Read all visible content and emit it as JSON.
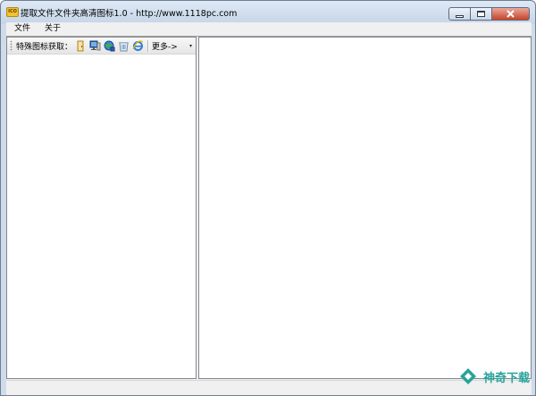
{
  "window": {
    "title": "提取文件文件夹高清图标1.0 - http://www.1118pc.com",
    "app_icon_text": "ICO"
  },
  "menu": {
    "items": [
      "文件",
      "关于"
    ]
  },
  "toolbar": {
    "label": "特殊图标获取：",
    "icons": [
      "folder-icon",
      "computer-icon",
      "network-icon",
      "recycle-bin-icon",
      "internet-explorer-icon"
    ],
    "more_label": "更多->",
    "overflow_glyph": "▾"
  },
  "watermark": {
    "text": "神奇下载",
    "accent": "#29a39a"
  },
  "colors": {
    "frame": "#cfdbe9",
    "close_button": "#c8432b"
  }
}
